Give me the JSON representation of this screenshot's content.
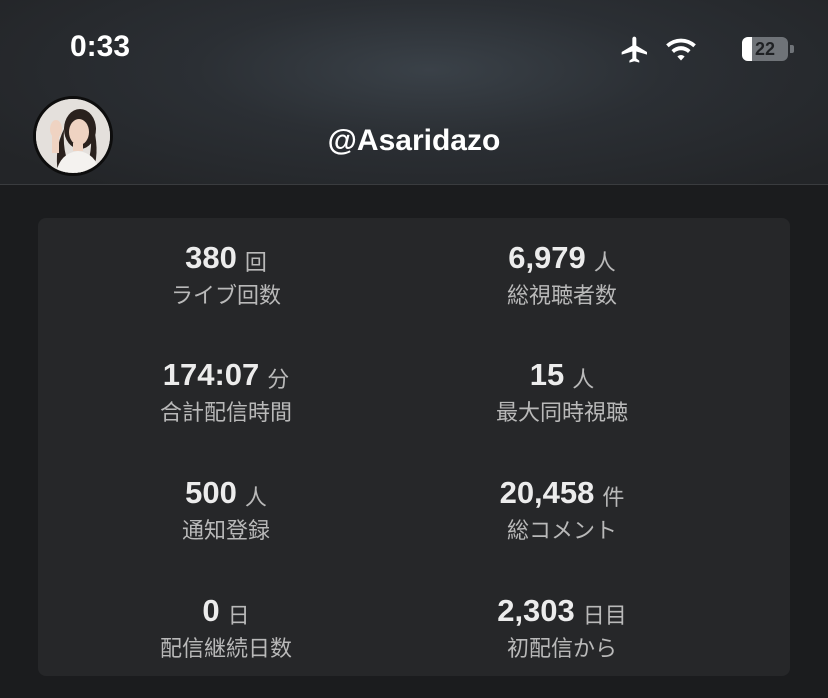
{
  "status_bar": {
    "time": "0:33",
    "battery": "22",
    "icons": [
      "airplane-icon",
      "wifi-icon",
      "battery-icon"
    ]
  },
  "profile": {
    "username": "@Asaridazo"
  },
  "stats": [
    {
      "value": "380",
      "unit": "回",
      "label": "ライブ回数"
    },
    {
      "value": "6,979",
      "unit": "人",
      "label": "総視聴者数"
    },
    {
      "value": "174:07",
      "unit": "分",
      "label": "合計配信時間"
    },
    {
      "value": "15",
      "unit": "人",
      "label": "最大同時視聴"
    },
    {
      "value": "500",
      "unit": "人",
      "label": "通知登録"
    },
    {
      "value": "20,458",
      "unit": "件",
      "label": "総コメント"
    },
    {
      "value": "0",
      "unit": "日",
      "label": "配信継続日数"
    },
    {
      "value": "2,303",
      "unit": "日目",
      "label": "初配信から"
    }
  ],
  "colors": {
    "background": "#1b1c1e",
    "card": "#262729",
    "value_text": "#ececec",
    "label_text": "#b9b9b9"
  }
}
